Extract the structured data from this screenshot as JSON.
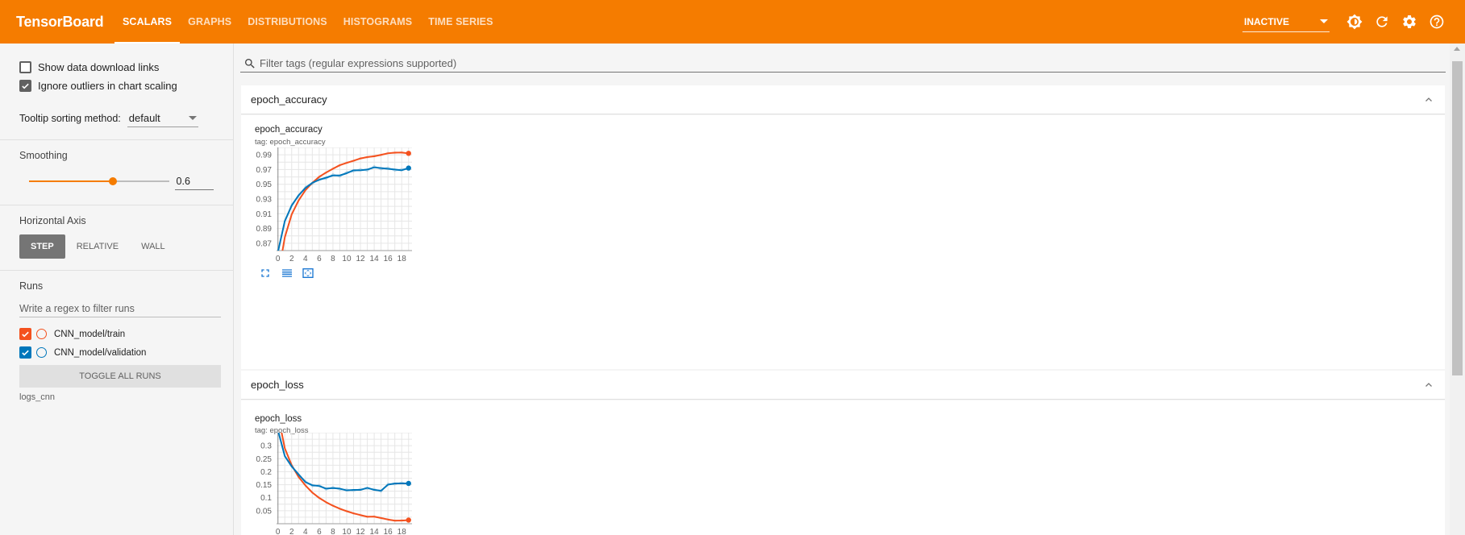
{
  "header": {
    "title": "TensorBoard",
    "tabs": [
      {
        "label": "SCALARS",
        "active": true
      },
      {
        "label": "GRAPHS",
        "active": false
      },
      {
        "label": "DISTRIBUTIONS",
        "active": false
      },
      {
        "label": "HISTOGRAMS",
        "active": false
      },
      {
        "label": "TIME SERIES",
        "active": false
      }
    ],
    "status": "INACTIVE",
    "icons": [
      "theme-toggle-icon",
      "refresh-icon",
      "settings-icon",
      "help-icon"
    ],
    "accent_color": "#f57c00"
  },
  "sidebar": {
    "show_download_links": {
      "label": "Show data download links",
      "checked": false
    },
    "ignore_outliers": {
      "label": "Ignore outliers in chart scaling",
      "checked": true
    },
    "tooltip_sorting": {
      "label": "Tooltip sorting method:",
      "value": "default"
    },
    "smoothing": {
      "label": "Smoothing",
      "value": "0.6",
      "fraction": 0.6
    },
    "horizontal_axis": {
      "label": "Horizontal Axis",
      "options": [
        "STEP",
        "RELATIVE",
        "WALL"
      ],
      "selected": "STEP"
    },
    "runs": {
      "label": "Runs",
      "filter_placeholder": "Write a regex to filter runs",
      "items": [
        {
          "label": "CNN_model/train",
          "checked": true,
          "color": "#f4511e"
        },
        {
          "label": "CNN_model/validation",
          "checked": true,
          "color": "#0077bb"
        }
      ],
      "toggle_label": "TOGGLE ALL RUNS",
      "logdir": "logs_cnn"
    }
  },
  "main": {
    "filter_placeholder": "Filter tags (regular expressions supported)",
    "cards": [
      {
        "name": "epoch_accuracy",
        "chart_title": "epoch_accuracy",
        "tag": "tag: epoch_accuracy"
      },
      {
        "name": "epoch_loss",
        "chart_title": "epoch_loss",
        "tag": "tag: epoch_loss"
      }
    ]
  },
  "chart_data": [
    {
      "type": "line",
      "title": "epoch_accuracy",
      "subtitle": "tag: epoch_accuracy",
      "x_ticks": [
        0,
        2,
        4,
        6,
        8,
        10,
        12,
        14,
        16,
        18
      ],
      "y_ticks": [
        0.87,
        0.89,
        0.91,
        0.93,
        0.95,
        0.97,
        0.99
      ],
      "xlim": [
        -0.2,
        19.5
      ],
      "ylim": [
        0.86,
        1.0
      ],
      "grid": true,
      "x": [
        0,
        1,
        2,
        3,
        4,
        5,
        6,
        7,
        8,
        9,
        10,
        11,
        12,
        13,
        14,
        15,
        16,
        17,
        18,
        19
      ],
      "series": [
        {
          "name": "CNN_model/train",
          "color": "#f4511e",
          "smoothed": true,
          "values": [
            0.824,
            0.878,
            0.909,
            0.928,
            0.942,
            0.952,
            0.96,
            0.966,
            0.971,
            0.976,
            0.979,
            0.982,
            0.985,
            0.987,
            0.988,
            0.99,
            0.992,
            0.993,
            0.993,
            0.992
          ]
        },
        {
          "name": "CNN_model/validation",
          "color": "#0077bb",
          "smoothed": true,
          "values": [
            0.858,
            0.9,
            0.921,
            0.935,
            0.945,
            0.952,
            0.956,
            0.959,
            0.962,
            0.962,
            0.965,
            0.969,
            0.969,
            0.97,
            0.973,
            0.972,
            0.971,
            0.97,
            0.969,
            0.972
          ]
        }
      ]
    },
    {
      "type": "line",
      "title": "epoch_loss",
      "subtitle": "tag: epoch_loss",
      "x_ticks": [
        0,
        2,
        4,
        6,
        8,
        10,
        12,
        14,
        16,
        18
      ],
      "y_ticks": [
        0.05,
        0.1,
        0.15,
        0.2,
        0.25,
        0.3
      ],
      "xlim": [
        -0.2,
        19.5
      ],
      "ylim": [
        0.0,
        0.35
      ],
      "grid": true,
      "x": [
        0,
        1,
        2,
        3,
        4,
        5,
        6,
        7,
        8,
        9,
        10,
        11,
        12,
        13,
        14,
        15,
        16,
        17,
        18,
        19
      ],
      "series": [
        {
          "name": "CNN_model/train",
          "color": "#f4511e",
          "smoothed": true,
          "values": [
            0.42,
            0.29,
            0.225,
            0.18,
            0.147,
            0.12,
            0.099,
            0.083,
            0.069,
            0.058,
            0.048,
            0.04,
            0.033,
            0.027,
            0.027,
            0.022,
            0.016,
            0.012,
            0.012,
            0.014
          ]
        },
        {
          "name": "CNN_model/validation",
          "color": "#0077bb",
          "smoothed": true,
          "values": [
            0.36,
            0.26,
            0.22,
            0.19,
            0.16,
            0.148,
            0.145,
            0.135,
            0.137,
            0.135,
            0.128,
            0.13,
            0.13,
            0.138,
            0.13,
            0.127,
            0.15,
            0.155,
            0.155,
            0.155
          ]
        }
      ]
    }
  ]
}
